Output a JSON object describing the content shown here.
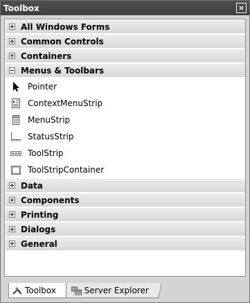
{
  "window": {
    "title": "Toolbox",
    "close_glyph": "×"
  },
  "categories": [
    {
      "label": "All Windows Forms",
      "expanded": false
    },
    {
      "label": "Common Controls",
      "expanded": false
    },
    {
      "label": "Containers",
      "expanded": false
    },
    {
      "label": "Menus & Toolbars",
      "expanded": true
    },
    {
      "label": "Data",
      "expanded": false
    },
    {
      "label": "Components",
      "expanded": false
    },
    {
      "label": "Printing",
      "expanded": false
    },
    {
      "label": "Dialogs",
      "expanded": false
    },
    {
      "label": "General",
      "expanded": false
    }
  ],
  "menus_items": [
    {
      "label": "Pointer",
      "icon": "pointer-icon"
    },
    {
      "label": "ContextMenuStrip",
      "icon": "contextmenustrip-icon"
    },
    {
      "label": "MenuStrip",
      "icon": "menustrip-icon"
    },
    {
      "label": "StatusStrip",
      "icon": "statusstrip-icon"
    },
    {
      "label": "ToolStrip",
      "icon": "toolstrip-icon"
    },
    {
      "label": "ToolStripContainer",
      "icon": "toolstripcontainer-icon"
    }
  ],
  "tabs": [
    {
      "label": "Toolbox",
      "icon": "toolbox-icon",
      "active": true
    },
    {
      "label": "Server Explorer",
      "icon": "server-explorer-icon",
      "active": false
    }
  ]
}
